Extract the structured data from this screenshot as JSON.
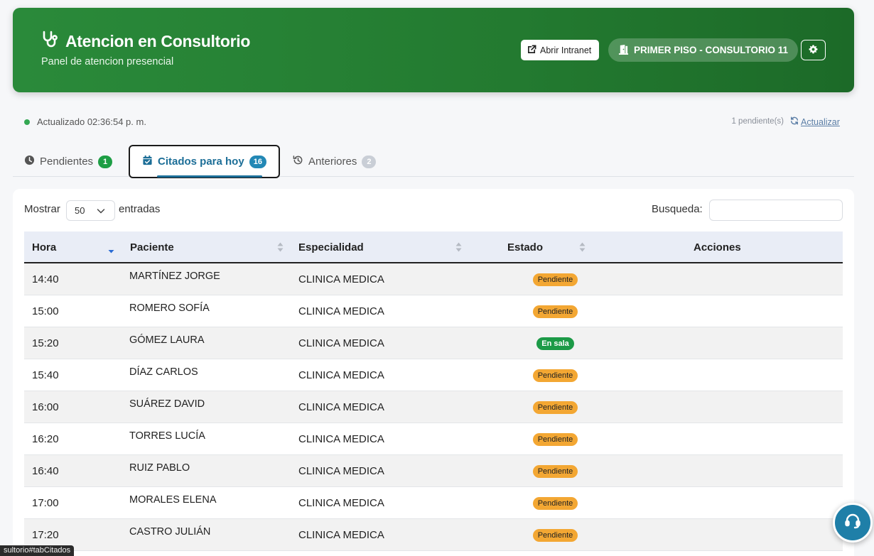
{
  "header": {
    "title": "Atencion en Consultorio",
    "subtitle": "Panel de atencion presencial",
    "intranet_label": "Abrir Intranet",
    "room_label": "PRIMER PISO - CONSULTORIO 11"
  },
  "status": {
    "updated": "Actualizado 02:36:54 p. m.",
    "pending_count": "1 pendiente(s)",
    "refresh_label": "Actualizar"
  },
  "tabs": [
    {
      "label": "Pendientes",
      "count": "1"
    },
    {
      "label": "Citados para hoy",
      "count": "16"
    },
    {
      "label": "Anteriores",
      "count": "2"
    }
  ],
  "table_controls": {
    "show_label": "Mostrar",
    "show_value": "50",
    "entries_label": "entradas",
    "search_label": "Busqueda:",
    "search_value": ""
  },
  "table": {
    "columns": [
      "Hora",
      "Paciente",
      "Especialidad",
      "Estado",
      "Acciones"
    ],
    "rows": [
      {
        "hora": "14:40",
        "paciente": "MARTÍNEZ JORGE",
        "especialidad": "CLINICA MEDICA",
        "estado": "Pendiente"
      },
      {
        "hora": "15:00",
        "paciente": "ROMERO SOFÍA",
        "especialidad": "CLINICA MEDICA",
        "estado": "Pendiente"
      },
      {
        "hora": "15:20",
        "paciente": "GÓMEZ LAURA",
        "especialidad": "CLINICA MEDICA",
        "estado": "En sala"
      },
      {
        "hora": "15:40",
        "paciente": "DÍAZ CARLOS",
        "especialidad": "CLINICA MEDICA",
        "estado": "Pendiente"
      },
      {
        "hora": "16:00",
        "paciente": "SUÁREZ DAVID",
        "especialidad": "CLINICA MEDICA",
        "estado": "Pendiente"
      },
      {
        "hora": "16:20",
        "paciente": "TORRES LUCÍA",
        "especialidad": "CLINICA MEDICA",
        "estado": "Pendiente"
      },
      {
        "hora": "16:40",
        "paciente": "RUIZ PABLO",
        "especialidad": "CLINICA MEDICA",
        "estado": "Pendiente"
      },
      {
        "hora": "17:00",
        "paciente": "MORALES ELENA",
        "especialidad": "CLINICA MEDICA",
        "estado": "Pendiente"
      },
      {
        "hora": "17:20",
        "paciente": "CASTRO JULIÁN",
        "especialidad": "CLINICA MEDICA",
        "estado": "Pendiente"
      }
    ]
  },
  "status_url": "sultorio#tabCitados",
  "colors": {
    "banner": "#237a30",
    "pending_badge": "#f3a733",
    "in_room_badge": "#1c9a47",
    "active_tab": "#1c6e97"
  },
  "icons": {
    "title": "stethoscope-icon",
    "intranet": "external-link-icon",
    "room": "door-icon",
    "settings": "gear-icon",
    "refresh": "refresh-icon",
    "tab_pendientes": "clock-icon",
    "tab_citados": "calendar-check-icon",
    "tab_anteriores": "history-icon",
    "help": "headset-icon"
  }
}
